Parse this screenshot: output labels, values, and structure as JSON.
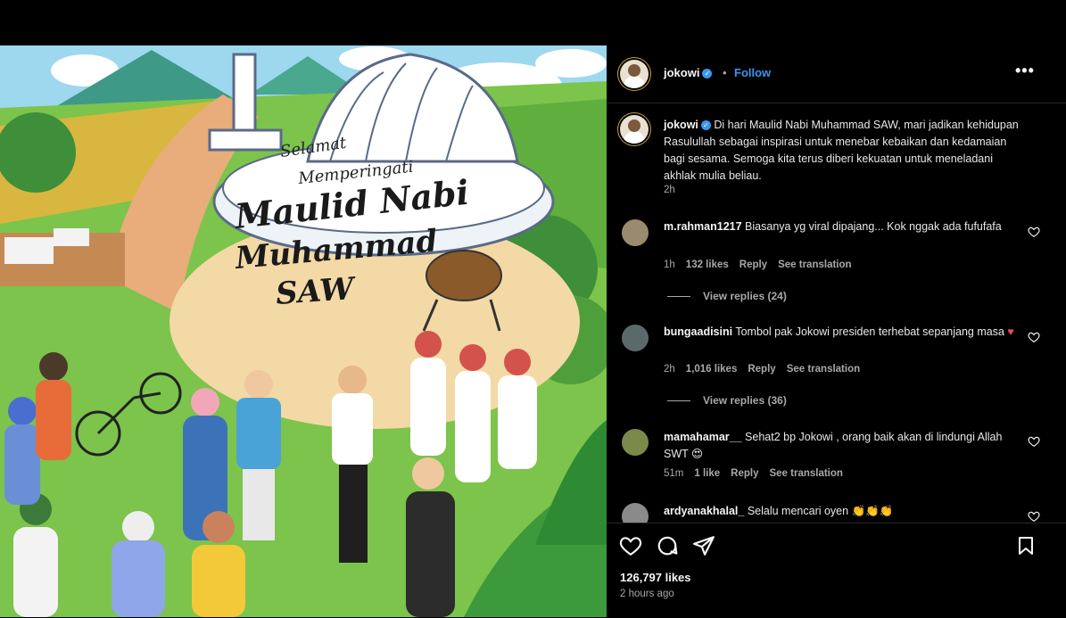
{
  "post": {
    "username": "jokowi",
    "follow_label": "Follow",
    "dot": "•",
    "more_label": "•••",
    "caption": "Di hari Maulid Nabi Muhammad SAW, mari jadikan kehidupan Rasulullah sebagai inspirasi untuk menebar kebaikan dan kedamaian bagi sesama. Semoga kita terus diberi kekuatan untuk meneladani akhlak mulia beliau.",
    "caption_time": "2h",
    "likes": "126,797 likes",
    "posted_ago": "2 hours ago"
  },
  "image": {
    "greeting_line1": "Selamat",
    "greeting_line2": "Memperingati",
    "title_line1": "Maulid Nabi",
    "title_line2": "Muhammad",
    "title_line3": "SAW"
  },
  "comments": [
    {
      "username": "m.rahman1217",
      "text": "Biasanya yg viral dipajang... Kok nggak ada fufufafa",
      "time": "1h",
      "likes": "132 likes",
      "reply": "Reply",
      "translate": "See translation",
      "view_replies": "View replies (24)"
    },
    {
      "username": "bungaadisini",
      "text": "Tombol pak Jokowi presiden terhebat sepanjang masa",
      "emoji": "♥",
      "time": "2h",
      "likes": "1,016 likes",
      "reply": "Reply",
      "translate": "See translation",
      "view_replies": "View replies (36)"
    },
    {
      "username": "mamahamar__",
      "text": "Sehat2 bp Jokowi , orang baik akan di lindungi Allah SWT",
      "emoji": "😍",
      "time": "51m",
      "likes": "1 like",
      "reply": "Reply",
      "translate": "See translation"
    },
    {
      "username": "ardyanakhalal_",
      "text": "Selalu mencari oyen",
      "emoji": "👏👏👏"
    }
  ],
  "icons": {
    "like": "heart-icon",
    "comment": "comment-icon",
    "share": "send-icon",
    "save": "bookmark-icon",
    "verified": "verified-badge-icon",
    "comment_like": "small-heart-icon"
  },
  "colors": {
    "accent": "#3897f0",
    "verified": "#3897f0",
    "like_red": "#ed4956",
    "muted": "#a8a8a8"
  }
}
